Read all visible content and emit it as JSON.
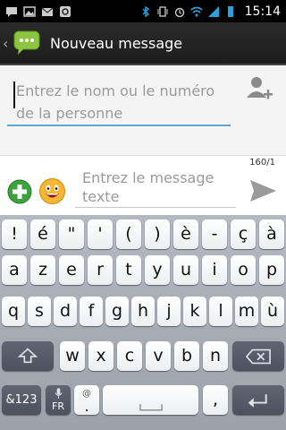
{
  "status_bar": {
    "time": "15:14",
    "icons": [
      "sms-notification-icon",
      "image-icon",
      "email-icon",
      "sync-icon",
      "bluetooth-icon",
      "vibrate-icon",
      "alarm-icon",
      "wifi-icon",
      "signal-icon",
      "battery-icon"
    ]
  },
  "action_bar": {
    "title": "Nouveau message",
    "app_icon": "messaging-icon"
  },
  "recipient": {
    "placeholder": "Entrez le nom ou le numéro de la personne",
    "add_contact_icon": "add-contact-icon"
  },
  "compose": {
    "counter": "160/1",
    "placeholder": "Entrez le message texte",
    "attach_icon": "add-attachment-icon",
    "smiley_icon": "smiley-icon",
    "send_icon": "send-icon"
  },
  "keyboard": {
    "row1": [
      "!",
      "é",
      "\"",
      "'",
      "(",
      ")",
      "è",
      "-",
      "ç",
      "à"
    ],
    "row2": [
      "a",
      "z",
      "e",
      "r",
      "t",
      "y",
      "u",
      "i",
      "o",
      "p"
    ],
    "row3": [
      "q",
      "s",
      "d",
      "f",
      "g",
      "h",
      "j",
      "k",
      "l",
      "m",
      "ù"
    ],
    "row4": [
      "w",
      "x",
      "c",
      "v",
      "b",
      "n",
      "'"
    ],
    "symbols_key": "&123",
    "lang_key": "FR",
    "at_key": "@",
    "dot_key": ".",
    "comma_key": ","
  }
}
